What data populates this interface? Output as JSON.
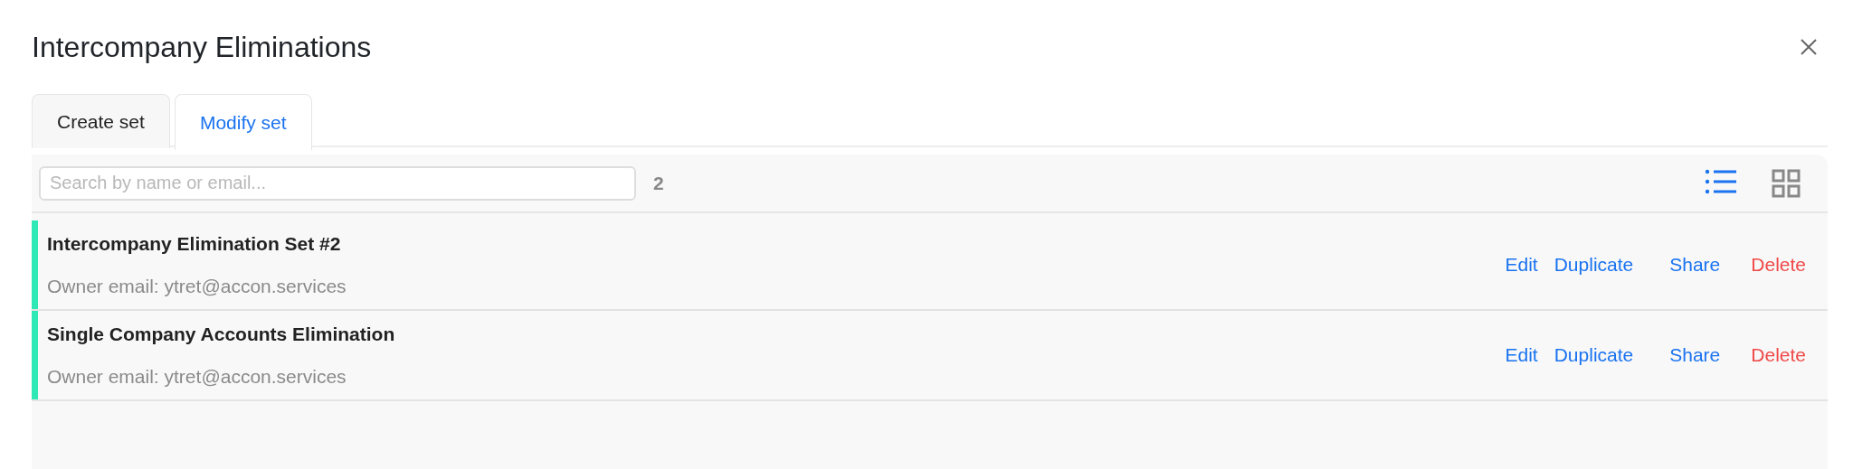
{
  "window": {
    "title": "Intercompany Eliminations"
  },
  "tabs": [
    {
      "label": "Create set",
      "selected": false
    },
    {
      "label": "Modify set",
      "selected": true
    }
  ],
  "search": {
    "placeholder": "Search by name or email...",
    "count": "2"
  },
  "views": [
    {
      "kind": "list",
      "selected": true
    },
    {
      "kind": "grid",
      "selected": false
    }
  ],
  "sets": [
    {
      "name": "Intercompany Elimination Set #2",
      "owner": "Owner email: ytret@accon.services",
      "actions": [
        {
          "label": "Edit",
          "kind": "link"
        },
        {
          "label": "Duplicate",
          "kind": "link"
        },
        {
          "label": "Share",
          "kind": "link"
        },
        {
          "label": "Delete",
          "kind": "danger"
        }
      ]
    },
    {
      "name": "Single Company Accounts Elimination",
      "owner": "Owner email: ytret@accon.services",
      "actions": [
        {
          "label": "Edit",
          "kind": "link"
        },
        {
          "label": "Duplicate",
          "kind": "link"
        },
        {
          "label": "Share",
          "kind": "link"
        },
        {
          "label": "Delete",
          "kind": "danger"
        }
      ]
    }
  ]
}
